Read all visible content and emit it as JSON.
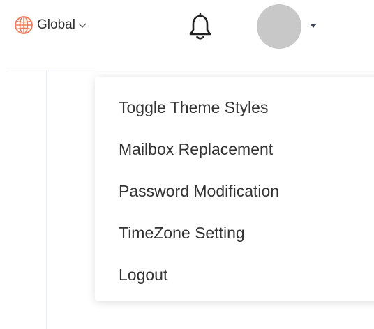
{
  "header": {
    "language_label": "Global",
    "language_icon": "globe-icon",
    "language_chevron_icon": "chevron-down-icon",
    "notification_icon": "bell-icon",
    "user_caret_icon": "caret-down-icon"
  },
  "colors": {
    "globe_accent": "#f07c5a",
    "avatar_placeholder": "#c8c8c8",
    "text": "#333333"
  },
  "user_menu": {
    "items": [
      {
        "label": "Toggle Theme Styles"
      },
      {
        "label": "Mailbox Replacement"
      },
      {
        "label": "Password Modification"
      },
      {
        "label": "TimeZone Setting"
      },
      {
        "label": "Logout"
      }
    ]
  }
}
